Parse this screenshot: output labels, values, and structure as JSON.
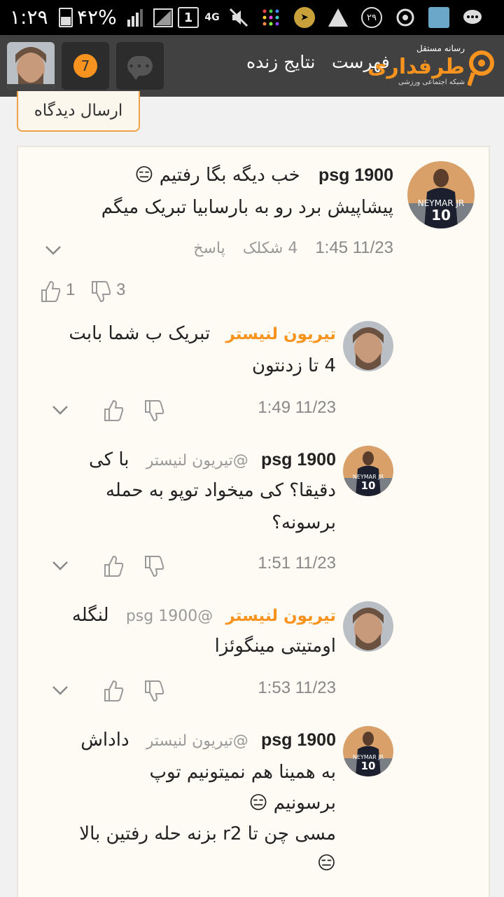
{
  "status_bar": {
    "time": "۱:۲۹",
    "battery": "۴۲%",
    "sim": "1",
    "network": "4G",
    "notif_count": "۲۹"
  },
  "app_bar": {
    "logo_top": "رسانه مستقل",
    "logo_main": "طرفداری",
    "logo_sub": "شبکه اجتماعی ورزشی",
    "nav_menu": "فهرست",
    "nav_live": "نتایج زنده",
    "notification_badge": "7"
  },
  "send_comment_label": "ارسال دیدگاه",
  "comment": {
    "author": "psg 1900",
    "text_line1": "خب دیگه بگا رفتیم 😑",
    "text_line2": "پیشاپیش برد رو به بارسابیا تبریک میگم",
    "date_time": "11/23 1:45",
    "attachments": "4 شکلک",
    "reply_label": "پاسخ",
    "likes": "1",
    "dislikes": "3"
  },
  "replies": [
    {
      "author": "تیریون لنیستر",
      "line1": "تبریک ب شما بابت",
      "line2": "4 تا زدنتون",
      "date_time": "11/23 1:49"
    },
    {
      "author": "psg 1900",
      "mention": "@تیریون لنیستر",
      "line1": "با کی",
      "line2": "دقیقا؟ کی میخواد توپو به حمله",
      "line3": "برسونه؟",
      "date_time": "11/23 1:51"
    },
    {
      "author": "تیریون لنیستر",
      "mention": "@psg 1900",
      "line1": "لنگله",
      "line2": "اومتیتی مینگوئزا",
      "date_time": "11/23 1:53"
    },
    {
      "author": "psg 1900",
      "mention": "@تیریون لنیستر",
      "line1": "داداش",
      "line2": "به همینا هم نمیتونیم توپ",
      "line3": "برسونیم 😑",
      "line4": "مسی چن تا r2 بزنه حله رفتین بالا",
      "line5": "😑"
    }
  ]
}
